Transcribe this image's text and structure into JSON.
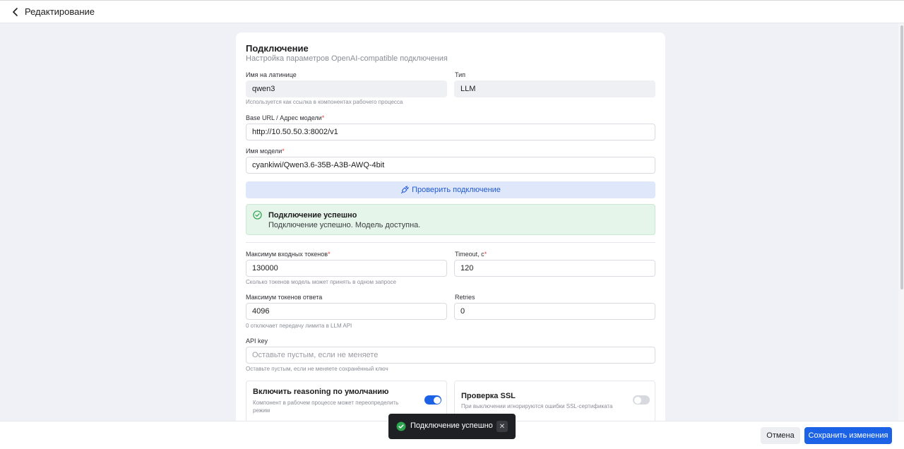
{
  "header": {
    "title": "Редактирование"
  },
  "section": {
    "title": "Подключение",
    "subtitle": "Настройка параметров OpenAI-compatible подключения"
  },
  "fields": {
    "latin_name": {
      "label": "Имя на латинице",
      "value": "qwen3",
      "hint": "Используется как ссылка в компонентах рабочего процесса"
    },
    "type": {
      "label": "Тип",
      "value": "LLM"
    },
    "base_url": {
      "label": "Base URL / Адрес модели",
      "required_mark": "*",
      "value": "http://10.50.50.3:8002/v1"
    },
    "model_name": {
      "label": "Имя модели",
      "required_mark": "*",
      "value": "cyankiwi/Qwen3.6-35B-A3B-AWQ-4bit"
    },
    "max_input_tokens": {
      "label": "Максимум входных токенов",
      "required_mark": "*",
      "value": "130000",
      "hint": "Сколько токенов модель может принять в одном запросе"
    },
    "timeout": {
      "label": "Timeout, с",
      "required_mark": "*",
      "value": "120"
    },
    "max_response_tokens": {
      "label": "Максимум токенов ответа",
      "value": "4096",
      "hint": "0 отключает передачу лимита в LLM API"
    },
    "retries": {
      "label": "Retries",
      "value": "0"
    },
    "api_key": {
      "label": "API key",
      "placeholder": "Оставьте пустым, если не меняете",
      "hint": "Оставьте пустым, если не меняете сохранённый ключ"
    }
  },
  "check_button": {
    "label": "Проверить подключение"
  },
  "status": {
    "title": "Подключение успешно",
    "message": "Подключение успешно. Модель доступна."
  },
  "toggles": {
    "reasoning": {
      "title": "Включить reasoning по умолчанию",
      "description": "Компонент в рабочем процессе может переопределить режим",
      "enabled": true
    },
    "ssl": {
      "title": "Проверка SSL",
      "description": "При выключении игнорируются ошибки SSL-сертификата",
      "enabled": false
    }
  },
  "footer": {
    "cancel_label": "Отмена",
    "save_label": "Сохранить изменения"
  },
  "toast": {
    "message": "Подключение успешно",
    "close_label": "✕"
  },
  "colors": {
    "accent": "#1b62e6",
    "success": "#2ea44f",
    "success_bg": "#e6f5ea",
    "check_bg": "#dfe8fb"
  }
}
